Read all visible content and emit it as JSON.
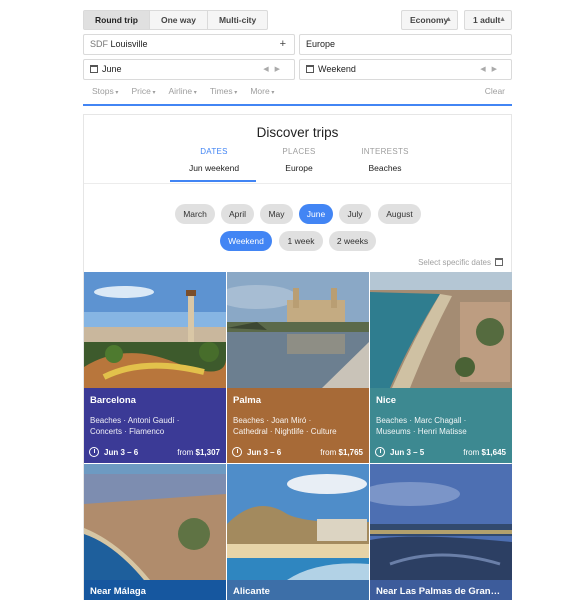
{
  "trip_types": [
    {
      "label": "Round trip",
      "active": true
    },
    {
      "label": "One way",
      "active": false
    },
    {
      "label": "Multi-city",
      "active": false
    }
  ],
  "cabin": "Economy",
  "passengers": "1 adult",
  "origin": {
    "code": "SDF",
    "city": "Louisville"
  },
  "destination": "Europe",
  "depart": "June",
  "return": "Weekend",
  "filters": [
    "Stops",
    "Price",
    "Airline",
    "Times",
    "More"
  ],
  "clear_label": "Clear",
  "discover": {
    "title": "Discover trips",
    "tabs": [
      {
        "label": "DATES",
        "value": "Jun weekend",
        "active": true
      },
      {
        "label": "PLACES",
        "value": "Europe",
        "active": false
      },
      {
        "label": "INTERESTS",
        "value": "Beaches",
        "active": false
      }
    ],
    "months": [
      {
        "label": "March",
        "selected": false
      },
      {
        "label": "April",
        "selected": false
      },
      {
        "label": "May",
        "selected": false
      },
      {
        "label": "June",
        "selected": true
      },
      {
        "label": "July",
        "selected": false
      },
      {
        "label": "August",
        "selected": false
      }
    ],
    "durations": [
      {
        "label": "Weekend",
        "selected": true
      },
      {
        "label": "1 week",
        "selected": false
      },
      {
        "label": "2 weeks",
        "selected": false
      }
    ],
    "specific_dates": "Select specific dates"
  },
  "destinations": [
    {
      "city": "Barcelona",
      "tags_line1": "Beaches · Antoni Gaudí ·",
      "tags_line2": "Concerts · Flamenco",
      "dates": "Jun 3 – 6",
      "from": "from",
      "price": "$1,307",
      "color": "#3b3a96"
    },
    {
      "city": "Palma",
      "tags_line1": "Beaches · Joan Miró ·",
      "tags_line2": "Cathedral · Nightlife · Culture",
      "dates": "Jun 3 – 6",
      "from": "from",
      "price": "$1,765",
      "color": "#a76a37"
    },
    {
      "city": "Nice",
      "tags_line1": "Beaches · Marc Chagall ·",
      "tags_line2": "Museums · Henri Matisse",
      "dates": "Jun 3 – 5",
      "from": "from",
      "price": "$1,645",
      "color": "#3d8991"
    },
    {
      "city": "Near Málaga",
      "color": "#16579f"
    },
    {
      "city": "Alicante",
      "color": "#3d6fa8"
    },
    {
      "city": "Near Las Palmas de Gran…",
      "color": "#3d5c9b"
    }
  ]
}
